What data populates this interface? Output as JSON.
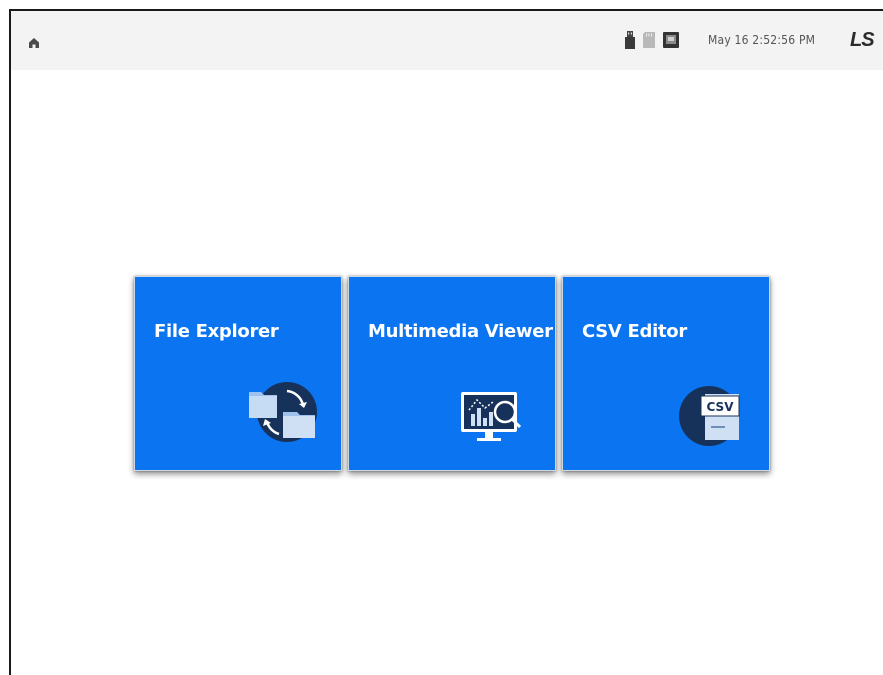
{
  "topbar": {
    "home_icon": "home-icon",
    "status_icons": [
      "usb-icon",
      "sd-card-icon",
      "network-icon"
    ],
    "datetime": "May 16 2:52:56 PM",
    "brand": "LS"
  },
  "tiles": [
    {
      "label": "File Explorer",
      "icon": "folder-sync-icon"
    },
    {
      "label": "Multimedia Viewer",
      "icon": "monitor-chart-search-icon"
    },
    {
      "label": "CSV Editor",
      "icon": "csv-document-icon",
      "icon_text": "CSV"
    }
  ],
  "colors": {
    "tile_bg": "#0b74f0",
    "topbar_bg": "#f3f3f3",
    "icon_dark": "#17325a",
    "icon_light": "#cfe0f5"
  }
}
